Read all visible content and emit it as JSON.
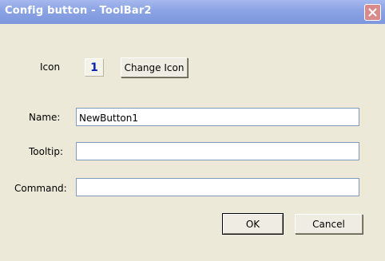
{
  "window": {
    "title": "Config button - ToolBar2"
  },
  "icon_row": {
    "label": "Icon",
    "icon_value": "1",
    "change_button": "Change Icon"
  },
  "form": {
    "name_label": "Name:",
    "name_value": "NewButton1",
    "tooltip_label": "Tooltip:",
    "tooltip_value": "",
    "command_label": "Command:",
    "command_value": ""
  },
  "buttons": {
    "ok": "OK",
    "cancel": "Cancel"
  },
  "colors": {
    "titlebar": "#8aa3e4",
    "dialog_bg": "#ece9d8",
    "icon_digit": "#0b22b8",
    "close_button": "#d98a8a"
  }
}
